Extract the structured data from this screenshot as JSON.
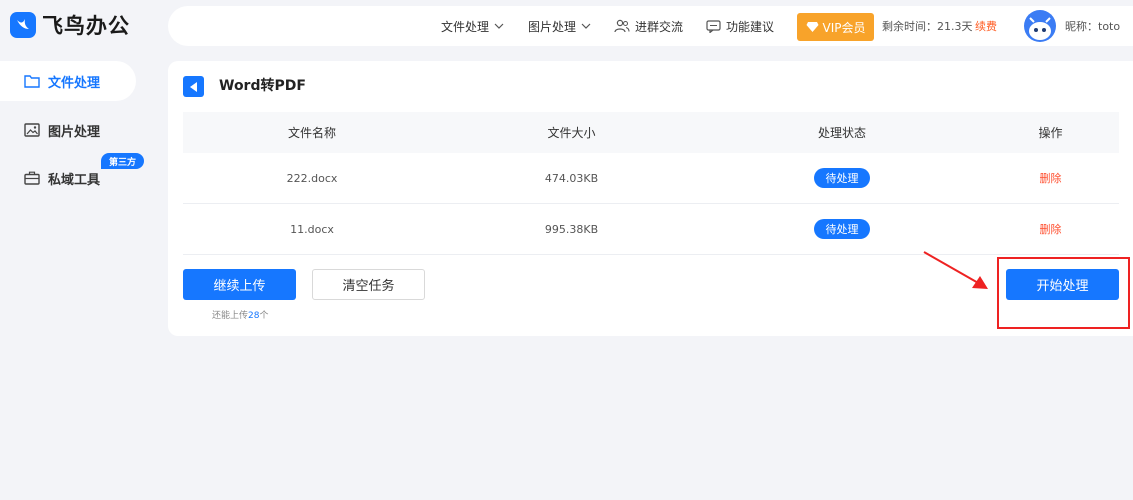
{
  "brand": {
    "name": "飞鸟办公"
  },
  "topbar": {
    "nav": [
      {
        "label": "文件处理",
        "icon": "chevron-down-icon"
      },
      {
        "label": "图片处理",
        "icon": "chevron-down-icon"
      },
      {
        "label": "进群交流",
        "icon": "people-icon"
      },
      {
        "label": "功能建议",
        "icon": "chat-icon"
      }
    ],
    "vip_label": "VIP会员",
    "remaining_label": "剩余时间：",
    "remaining_value": "21.3天",
    "renew_label": "续费",
    "nickname": "昵称：toto"
  },
  "sidebar": {
    "items": [
      {
        "label": "文件处理",
        "icon": "folder-icon",
        "active": true
      },
      {
        "label": "图片处理",
        "icon": "image-icon",
        "active": false
      },
      {
        "label": "私域工具",
        "icon": "toolbox-icon",
        "active": false
      }
    ],
    "badge": "第三方"
  },
  "main": {
    "title": "Word转PDF",
    "columns": [
      "文件名称",
      "文件大小",
      "处理状态",
      "操作"
    ],
    "rows": [
      {
        "name": "222.docx",
        "size": "474.03KB",
        "status": "待处理",
        "action": "删除"
      },
      {
        "name": "11.docx",
        "size": "995.38KB",
        "status": "待处理",
        "action": "删除"
      }
    ],
    "continue_upload": "继续上传",
    "clear_tasks": "清空任务",
    "hint_prefix": "还能上传",
    "hint_count": "28",
    "hint_suffix": "个",
    "start_button": "开始处理"
  },
  "colors": {
    "accent": "#1677ff",
    "vip": "#f8a32a",
    "danger": "#ff4d2d",
    "annotation": "#ee2222"
  }
}
